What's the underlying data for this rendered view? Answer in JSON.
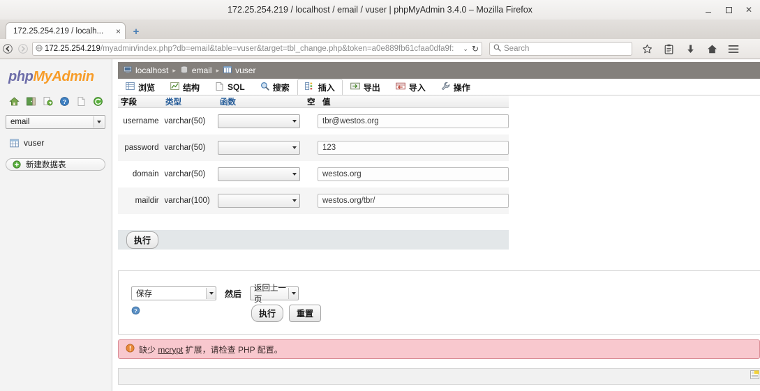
{
  "window": {
    "title": "172.25.254.219 / localhost / email / vuser | phpMyAdmin 3.4.0 – Mozilla Firefox",
    "minimize_label": "–",
    "maximize_label": "□",
    "close_label": "×"
  },
  "browser": {
    "tab": {
      "title": "172.25.254.219 / localh...",
      "close_label": "×"
    },
    "new_tab_label": "+",
    "url": {
      "host": "172.25.254.219",
      "path": "/myadmin/index.php?db=email&table=vuser&target=tbl_change.php&token=a0e889fb61cfaa0dfa9f:",
      "dropdown_label": "⌄",
      "reload_label": "↻"
    },
    "search": {
      "placeholder": "Search"
    },
    "toolbar_icons": [
      "bookmark-star-icon",
      "reader-icon",
      "downloads-icon",
      "home-icon",
      "menu-icon"
    ]
  },
  "sidebar": {
    "logo": {
      "part1": "php",
      "part2": "MyAdmin"
    },
    "icons": [
      "home-icon",
      "logout-icon",
      "sql-query-icon",
      "help-icon",
      "documentation-icon",
      "reload-icon"
    ],
    "database_select": {
      "value": "email"
    },
    "table_item": {
      "label": "vuser",
      "icon": "table-icon"
    },
    "new_table_button": {
      "label": "新建数据表",
      "icon": "plus-circle-icon"
    }
  },
  "main": {
    "breadcrumb": [
      {
        "label": "localhost",
        "icon": "server-icon"
      },
      {
        "label": "email",
        "icon": "database-icon"
      },
      {
        "label": "vuser",
        "icon": "table-icon"
      }
    ],
    "breadcrumb_separator": "▸",
    "tabs": [
      {
        "label": "浏览",
        "icon": "browse-icon",
        "active": false
      },
      {
        "label": "结构",
        "icon": "structure-icon",
        "active": false
      },
      {
        "label": "SQL",
        "icon": "sql-icon",
        "active": false
      },
      {
        "label": "搜索",
        "icon": "search-icon",
        "active": false
      },
      {
        "label": "插入",
        "icon": "insert-icon",
        "active": true
      },
      {
        "label": "导出",
        "icon": "export-icon",
        "active": false
      },
      {
        "label": "导入",
        "icon": "import-icon",
        "active": false
      },
      {
        "label": "操作",
        "icon": "operations-icon",
        "active": false
      }
    ],
    "field_table": {
      "headers": {
        "field": "字段",
        "type": "类型",
        "function": "函数",
        "null": "空",
        "value": "值"
      },
      "rows": [
        {
          "field": "username",
          "type": "varchar(50)",
          "function": "",
          "value": "tbr@westos.org"
        },
        {
          "field": "password",
          "type": "varchar(50)",
          "function": "",
          "value": "123"
        },
        {
          "field": "domain",
          "type": "varchar(50)",
          "function": "",
          "value": "westos.org"
        },
        {
          "field": "maildir",
          "type": "varchar(100)",
          "function": "",
          "value": "westos.org/tbr/"
        }
      ]
    },
    "execute_button_top": "执行",
    "bottom_panel": {
      "save_select_value": "保存",
      "then_label": "然后",
      "after_select_value": "返回上一页",
      "execute_button": "执行",
      "reset_button": "重置",
      "help_icon": "help-icon"
    },
    "error": {
      "icon": "warning-icon",
      "prefix": "缺少 ",
      "link": "mcrypt",
      "suffix": " 扩展，请检查 PHP 配置。"
    },
    "bottom_bar_icon": "note-icon"
  }
}
